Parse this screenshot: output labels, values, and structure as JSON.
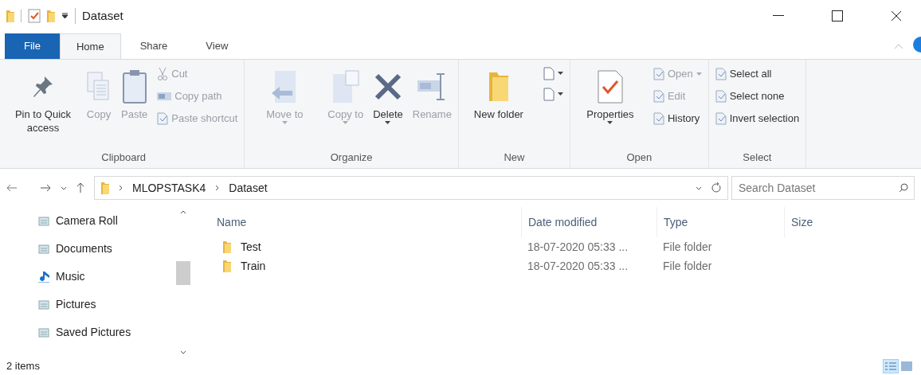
{
  "window": {
    "title": "Dataset"
  },
  "tabs": [
    {
      "label": "File",
      "kind": "file",
      "selected": false
    },
    {
      "label": "Home",
      "kind": "tab",
      "selected": true
    },
    {
      "label": "Share",
      "kind": "tab",
      "selected": false
    },
    {
      "label": "View",
      "kind": "tab",
      "selected": false
    }
  ],
  "ribbon": [
    {
      "label": "Clipboard",
      "columns": [
        [
          {
            "kind": "large",
            "label": "Pin to Quick access",
            "disabled": false
          }
        ],
        [
          {
            "kind": "large",
            "label": "Copy",
            "disabled": true
          }
        ],
        [
          {
            "kind": "large",
            "label": "Paste",
            "disabled": true
          }
        ],
        [
          {
            "kind": "small",
            "label": "Cut",
            "disabled": true
          },
          {
            "kind": "small",
            "label": "Copy path",
            "disabled": true
          },
          {
            "kind": "small",
            "label": "Paste shortcut",
            "disabled": true
          }
        ]
      ]
    },
    {
      "label": "Organize",
      "columns": [
        [
          {
            "kind": "large",
            "label": "Move to",
            "disabled": true,
            "dropdown": true
          }
        ],
        [
          {
            "kind": "large",
            "label": "Copy to",
            "disabled": true,
            "dropdown": true
          }
        ],
        [
          {
            "kind": "large",
            "label": "Delete",
            "disabled": false,
            "dropdown": true
          }
        ],
        [
          {
            "kind": "large",
            "label": "Rename",
            "disabled": true
          }
        ]
      ]
    },
    {
      "label": "New",
      "columns": [
        [
          {
            "kind": "large",
            "label": "New folder",
            "disabled": false
          }
        ],
        [
          {
            "kind": "icon",
            "disabled": false
          },
          {
            "kind": "icon",
            "disabled": false
          }
        ]
      ]
    },
    {
      "label": "Open",
      "columns": [
        [
          {
            "kind": "large",
            "label": "Properties",
            "disabled": false,
            "dropdown": true
          }
        ],
        [
          {
            "kind": "small",
            "label": "Open",
            "disabled": true,
            "dropdown": true
          },
          {
            "kind": "small",
            "label": "Edit",
            "disabled": true
          },
          {
            "kind": "small",
            "label": "History",
            "disabled": false
          }
        ]
      ]
    },
    {
      "label": "Select",
      "columns": [
        [
          {
            "kind": "small",
            "label": "Select all",
            "disabled": false
          },
          {
            "kind": "small",
            "label": "Select none",
            "disabled": false
          },
          {
            "kind": "small",
            "label": "Invert selection",
            "disabled": false
          }
        ]
      ]
    }
  ],
  "address": {
    "path": [
      "MLOPSTASK4",
      "Dataset"
    ],
    "search": {
      "placeholder": "Search Dataset"
    }
  },
  "sidebar": {
    "items": [
      "Camera Roll",
      "Documents",
      "Music",
      "Pictures",
      "Saved Pictures"
    ]
  },
  "table": {
    "columns": [
      "Name",
      "Date modified",
      "Type",
      "Size"
    ],
    "rows": [
      {
        "name": "Test",
        "date": "18-07-2020 05:33 ...",
        "type": "File folder"
      },
      {
        "name": "Train",
        "date": "18-07-2020 05:33 ...",
        "type": "File folder"
      }
    ]
  },
  "status_bar": {
    "text": "2 items",
    "views": [
      {
        "kind": "details",
        "selected": true
      },
      {
        "kind": "large",
        "selected": false
      }
    ]
  }
}
